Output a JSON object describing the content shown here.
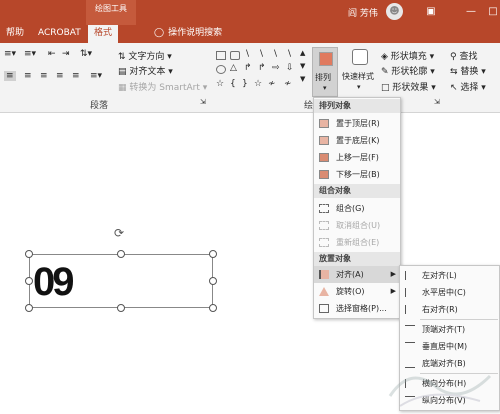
{
  "titlebar": {
    "context_tab": "绘图工具",
    "user": "阎 芳伟",
    "ribbon_display_icon": "ribbon-display-icon",
    "minimize": "—",
    "restore": "□"
  },
  "tabs": [
    "帮助",
    "ACROBAT",
    "格式"
  ],
  "tell_me": "操作说明搜索",
  "ribbon": {
    "paragraph": {
      "text_direction": "文字方向",
      "align_text": "对齐文本",
      "convert_smartart": "转换为 SmartArt",
      "label": "段落"
    },
    "drawing": {
      "arrange": "排列",
      "quick_styles": "快速样式",
      "shape_fill": "形状填充",
      "shape_outline": "形状轮廓",
      "shape_effects": "形状效果",
      "label": "绘"
    },
    "editing": {
      "find": "查找",
      "replace": "替换",
      "select": "选择"
    }
  },
  "slide": {
    "text": "09"
  },
  "arrange_menu": {
    "sections": [
      {
        "header": "排列对象",
        "items": [
          {
            "label": "置于顶层(R)",
            "enabled": true
          },
          {
            "label": "置于底层(K)",
            "enabled": true
          },
          {
            "label": "上移一层(F)",
            "enabled": true
          },
          {
            "label": "下移一层(B)",
            "enabled": true
          }
        ]
      },
      {
        "header": "组合对象",
        "items": [
          {
            "label": "组合(G)",
            "enabled": true
          },
          {
            "label": "取消组合(U)",
            "enabled": false
          },
          {
            "label": "重新组合(E)",
            "enabled": false
          }
        ]
      },
      {
        "header": "放置对象",
        "items": [
          {
            "label": "对齐(A)",
            "enabled": true,
            "submenu": true,
            "highlighted": true
          },
          {
            "label": "旋转(O)",
            "enabled": true,
            "submenu": true
          },
          {
            "label": "选择窗格(P)...",
            "enabled": true
          }
        ]
      }
    ]
  },
  "align_submenu": {
    "items": [
      "左对齐(L)",
      "水平居中(C)",
      "右对齐(R)",
      "顶端对齐(T)",
      "垂直居中(M)",
      "底端对齐(B)",
      "横向分布(H)",
      "纵向分布(V)"
    ]
  },
  "colors": {
    "ppt_accent": "#b7472a",
    "ribbon_bg": "#f3f3f3",
    "menu_highlight": "#d8d8d8"
  }
}
